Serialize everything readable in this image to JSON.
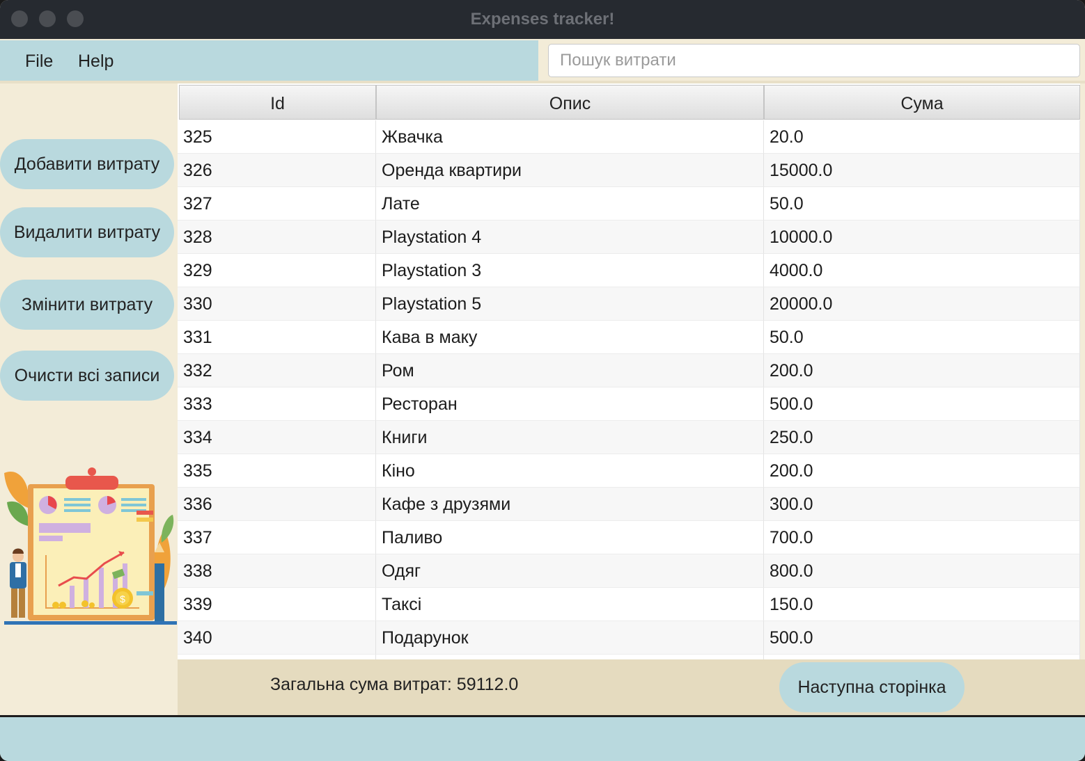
{
  "window": {
    "title": "Expenses tracker!"
  },
  "menu": {
    "items": [
      "File",
      "Help"
    ]
  },
  "search": {
    "placeholder": "Пошук витрати"
  },
  "sidebar": {
    "buttons": [
      "Добавити витрату",
      "Видалити витрату",
      "Змінити витрату",
      "Очисти всі записи"
    ]
  },
  "table": {
    "columns": [
      "Id",
      "Опис",
      "Сума"
    ],
    "rows": [
      [
        "325",
        "Жвачка",
        "20.0"
      ],
      [
        "326",
        "Оренда квартири",
        "15000.0"
      ],
      [
        "327",
        "Лате",
        "50.0"
      ],
      [
        "328",
        "Playstation 4",
        "10000.0"
      ],
      [
        "329",
        "Playstation 3",
        "4000.0"
      ],
      [
        "330",
        "Playstation 5",
        "20000.0"
      ],
      [
        "331",
        "Кава в маку",
        "50.0"
      ],
      [
        "332",
        "Ром",
        "200.0"
      ],
      [
        "333",
        "Ресторан",
        "500.0"
      ],
      [
        "334",
        "Книги",
        "250.0"
      ],
      [
        "335",
        "Кіно",
        "200.0"
      ],
      [
        "336",
        "Кафе з друзями",
        "300.0"
      ],
      [
        "337",
        "Паливо",
        "700.0"
      ],
      [
        "338",
        "Одяг",
        "800.0"
      ],
      [
        "339",
        "Таксі",
        "150.0"
      ],
      [
        "340",
        "Подарунок",
        "500.0"
      ]
    ]
  },
  "footer": {
    "total": "Загальна сума витрат: 59112.0",
    "next_button": "Наступна сторінка"
  },
  "colors": {
    "accent": "#b9d9de",
    "background": "#f3ecd8",
    "footer": "#e5dbbf",
    "titlebar": "#262a30"
  }
}
